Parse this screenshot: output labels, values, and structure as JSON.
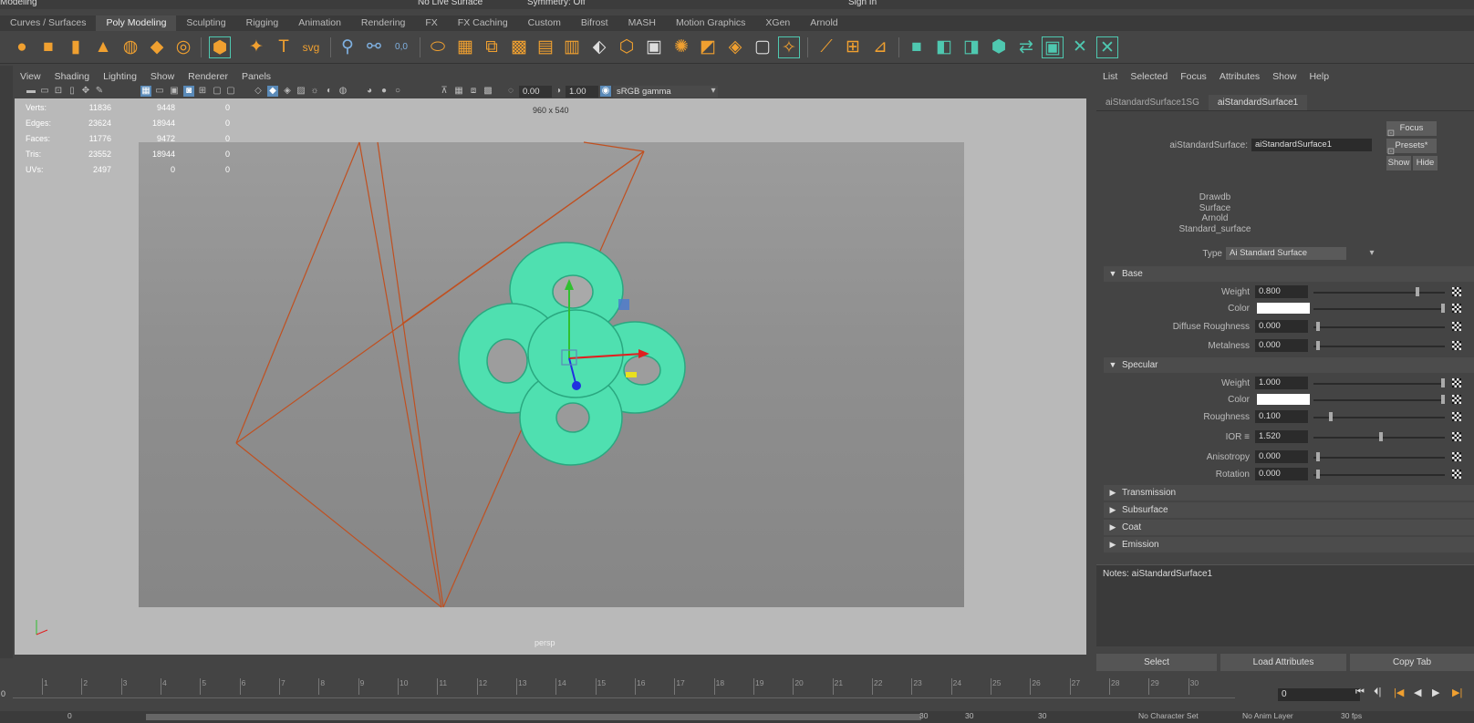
{
  "top": {
    "mode": "Modeling",
    "live_surface": "No Live Surface",
    "symmetry": "Symmetry: Off",
    "sign_in": "Sign In"
  },
  "shelf_tabs": [
    "Curves / Surfaces",
    "Poly Modeling",
    "Sculpting",
    "Rigging",
    "Animation",
    "Rendering",
    "FX",
    "FX Caching",
    "Custom",
    "Bifrost",
    "MASH",
    "Motion Graphics",
    "XGen",
    "Arnold"
  ],
  "viewport": {
    "menu": [
      "View",
      "Shading",
      "Lighting",
      "Show",
      "Renderer",
      "Panels"
    ],
    "value1": "0.00",
    "value2": "1.00",
    "color_space": "sRGB gamma",
    "resolution": "960 x 540",
    "camera": "persp",
    "hud": {
      "labels": [
        "Verts:",
        "Edges:",
        "Faces:",
        "Tris:",
        "UVs:"
      ],
      "col1": [
        "11836",
        "23624",
        "11776",
        "23552",
        "2497"
      ],
      "col2": [
        "9448",
        "18944",
        "9472",
        "18944",
        "0"
      ],
      "col3": [
        "0",
        "0",
        "0",
        "0",
        "0"
      ]
    }
  },
  "attr_editor": {
    "menu": [
      "List",
      "Selected",
      "Focus",
      "Attributes",
      "Show",
      "Help"
    ],
    "tabs": [
      "aiStandardSurface1SG",
      "aiStandardSurface1"
    ],
    "node_label": "aiStandardSurface:",
    "node_name": "aiStandardSurface1",
    "buttons": {
      "focus": "Focus",
      "presets": "Presets*",
      "show": "Show",
      "hide": "Hide"
    },
    "classification": [
      "Drawdb",
      "Surface",
      "Arnold",
      "Standard_surface"
    ],
    "type_label": "Type",
    "type_value": "Ai Standard Surface",
    "base": {
      "title": "Base",
      "weight_label": "Weight",
      "weight": "0.800",
      "color_label": "Color",
      "diffuse_roughness_label": "Diffuse Roughness",
      "diffuse_roughness": "0.000",
      "metalness_label": "Metalness",
      "metalness": "0.000"
    },
    "specular": {
      "title": "Specular",
      "weight_label": "Weight",
      "weight": "1.000",
      "color_label": "Color",
      "roughness_label": "Roughness",
      "roughness": "0.100",
      "ior_label": "IOR",
      "ior": "1.520",
      "anisotropy_label": "Anisotropy",
      "anisotropy": "0.000",
      "rotation_label": "Rotation",
      "rotation": "0.000"
    },
    "collapsed_sections": [
      "Transmission",
      "Subsurface",
      "Coat",
      "Emission"
    ],
    "notes": "Notes: aiStandardSurface1",
    "bottom_buttons": [
      "Select",
      "Load Attributes",
      "Copy Tab"
    ]
  },
  "timeline": {
    "ticks": [
      "1",
      "2",
      "3",
      "4",
      "5",
      "6",
      "7",
      "8",
      "9",
      "10",
      "11",
      "12",
      "13",
      "14",
      "15",
      "16",
      "17",
      "18",
      "19",
      "20",
      "21",
      "22",
      "23",
      "24",
      "25",
      "26",
      "27",
      "28",
      "29",
      "30"
    ],
    "start": "0",
    "current_frame": "0",
    "range_start": "0",
    "range_a": "30",
    "range_b": "30",
    "range_c": "30",
    "char_set": "No Character Set",
    "anim_layer": "No Anim Layer",
    "fps": "30 fps"
  },
  "colors": {
    "accent": "#5a8ab8",
    "knot": "#4fe0b0",
    "camera_lines": "#c05020"
  }
}
